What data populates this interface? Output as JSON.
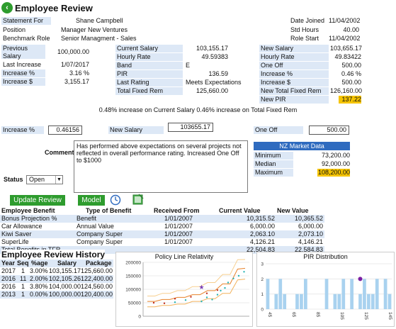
{
  "title": "Employee Review",
  "header": {
    "statement_for_label": "Statement For",
    "statement_for_value": "Shane Campbell",
    "date_joined_label": "Date Joined",
    "date_joined_value": "11/04/2002",
    "position_label": "Position",
    "position_value": "Manager New Ventures",
    "std_hours_label": "Std Hours",
    "std_hours_value": "40.00",
    "benchmark_label": "Benchmark Role",
    "benchmark_value": "Senior Managment - Sales",
    "role_start_label": "Role Start",
    "role_start_value": "11/04/2002"
  },
  "previous": {
    "previous_salary_label1": "Previous",
    "previous_salary_label2": "Salary",
    "previous_salary_value": "100,000.00",
    "last_increase_label": "Last Increase",
    "last_increase_value": "1/07/2017",
    "increase_pct_label": "Increase %",
    "increase_pct_value": "3.16 %",
    "increase_amt_label": "Increase $",
    "increase_amt_value": "3,155.17"
  },
  "current": {
    "current_salary_label": "Current Salary",
    "current_salary_value": "103,155.17",
    "hourly_rate_label": "Hourly Rate",
    "hourly_rate_value": "49.59383",
    "band_label": "Band",
    "band_value": "E",
    "pir_label": "PIR",
    "pir_value": "136.59",
    "last_rating_label": "Last Rating",
    "last_rating_value": "Meets Expectations",
    "total_fixed_label": "Total Fixed Rem",
    "total_fixed_value": "125,660.00"
  },
  "newvals": {
    "new_salary_label": "New Salary",
    "new_salary_value": "103,655.17",
    "hourly_rate_label": "Hourly Rate",
    "hourly_rate_value": "49.83422",
    "one_off_label": "One Off",
    "one_off_value": "500.00",
    "increase_pct_label": "Increase %",
    "increase_pct_value": "0.46 %",
    "increase_amt_label": "Increase $",
    "increase_amt_value": "500.00",
    "new_total_label": "New Total Fixed Rem",
    "new_total_value": "126,160.00",
    "new_pir_label": "New PIR",
    "new_pir_value": "137.22"
  },
  "summary_text": "0.48% increase on Current Salary 0.46% increase on Total Fixed Rem",
  "inputs": {
    "increase_pct_label": "Increase %",
    "increase_pct_value": "0.46156",
    "new_salary_label": "New Salary",
    "new_salary_value": "103655.17",
    "one_off_label": "One Off",
    "one_off_value": "500.00",
    "comment_label": "Comment",
    "comment_value": "Has performed above expectations on several projects not reflected in overall performance rating.  Increased One Off to $1000",
    "status_label": "Status",
    "status_value": "Open"
  },
  "nz_market": {
    "header": "NZ Market Data",
    "minimum_label": "Minimum",
    "minimum_value": "73,200.00",
    "median_label": "Median",
    "median_value": "92,000.00",
    "maximum_label": "Maximum",
    "maximum_value": "108,200.00"
  },
  "buttons": {
    "update_review": "Update Review",
    "model": "Model"
  },
  "benefits": {
    "headers": [
      "Employee Benefit",
      "Type of Benefit",
      "Received From",
      "Current Value",
      "New Value"
    ],
    "rows": [
      [
        "Bonus Projection %",
        "Benefit",
        "1/01/2007",
        "10,315.52",
        "10,365.52"
      ],
      [
        "Car Allowance",
        "Annual Value",
        "1/01/2007",
        "6,000.00",
        "6,000.00"
      ],
      [
        "Kiwi Saver",
        "Company Super",
        "1/01/2007",
        "2,063.10",
        "2,073.10"
      ],
      [
        "SuperLife",
        "Company Super",
        "1/01/2007",
        "4,126.21",
        "4,146.21"
      ]
    ],
    "total_label": "Total Benefits in TFR",
    "total_current": "22,504.83",
    "total_new": "22,584.83"
  },
  "history": {
    "title": "Employee Review History",
    "headers": [
      "Year",
      "Seq",
      "%age",
      "Salary",
      "Package"
    ],
    "rows": [
      [
        "2017",
        "1",
        "3.00%",
        "103,155.17",
        "125,660.00"
      ],
      [
        "2016",
        "11",
        "2.00%",
        "102,105.26",
        "122,400.00"
      ],
      [
        "2016",
        "1",
        "3.80%",
        "104,000.00",
        "124,560.00"
      ],
      [
        "2013",
        "1",
        "0.00%",
        "100,000.00",
        "120,400.00"
      ]
    ]
  },
  "chart_data": [
    {
      "type": "line",
      "title": "Policy Line Relativity",
      "yticks": [
        "200000",
        "150000",
        "100000",
        "50000",
        "0"
      ],
      "ylim": [
        0,
        200000
      ],
      "series": [
        {
          "color": "#e8822a",
          "values": [
            55000,
            55000,
            62000,
            62000,
            70000,
            70000,
            80000,
            80000,
            95000,
            95000,
            120000,
            120000,
            175000,
            178000
          ]
        },
        {
          "color": "#f2b25c",
          "values": [
            35000,
            35000,
            40000,
            40000,
            45000,
            45000,
            55000,
            55000,
            65000,
            65000,
            85000,
            85000,
            135000,
            138000
          ]
        },
        {
          "color": "#f7cf8f",
          "values": [
            75000,
            75000,
            85000,
            85000,
            95000,
            95000,
            110000,
            110000,
            125000,
            125000,
            155000,
            155000,
            210000,
            212000
          ]
        }
      ],
      "points_teal": [
        [
          0.55,
          55000
        ],
        [
          0.6,
          70000
        ],
        [
          0.65,
          62000
        ],
        [
          0.7,
          80000
        ],
        [
          0.73,
          95000
        ],
        [
          0.77,
          105000
        ],
        [
          0.8,
          125000
        ],
        [
          0.85,
          140000
        ],
        [
          0.9,
          150000
        ],
        [
          0.95,
          165000
        ],
        [
          0.3,
          52000
        ],
        [
          0.4,
          60000
        ]
      ],
      "points_red": [
        [
          0.1,
          50000
        ],
        [
          0.2,
          48000
        ],
        [
          0.3,
          65000
        ],
        [
          0.45,
          72000
        ],
        [
          0.6,
          85000
        ],
        [
          0.7,
          97000
        ]
      ],
      "star": [
        0.55,
        108000
      ],
      "star_color": "#7b3fb5",
      "point_teal_color": "#2ab5b5",
      "point_red_color": "#c03020"
    },
    {
      "type": "bar",
      "title": "PIR Distribution",
      "yticks": [
        "3",
        "2",
        "1",
        "0"
      ],
      "ylim": [
        0,
        3
      ],
      "xticks": [
        "45",
        "65",
        "85",
        "105",
        "125",
        "145"
      ],
      "values": [
        2,
        0,
        1,
        2,
        1,
        0,
        0,
        1,
        1,
        2,
        0,
        0,
        0,
        0,
        2,
        0,
        1,
        1,
        2,
        0,
        2,
        0,
        1,
        2,
        1,
        1,
        2,
        0,
        2,
        1
      ],
      "bar_color": "#a9d2ef",
      "marker_index": 22,
      "marker_value": 2,
      "marker_color": "#7b1fa2"
    }
  ],
  "colors": {
    "accent_green": "#2e9c2e",
    "row_blue": "#dde8f6",
    "nz_header_blue": "#2f6bbf",
    "highlight_yellow": "#f5c400"
  }
}
